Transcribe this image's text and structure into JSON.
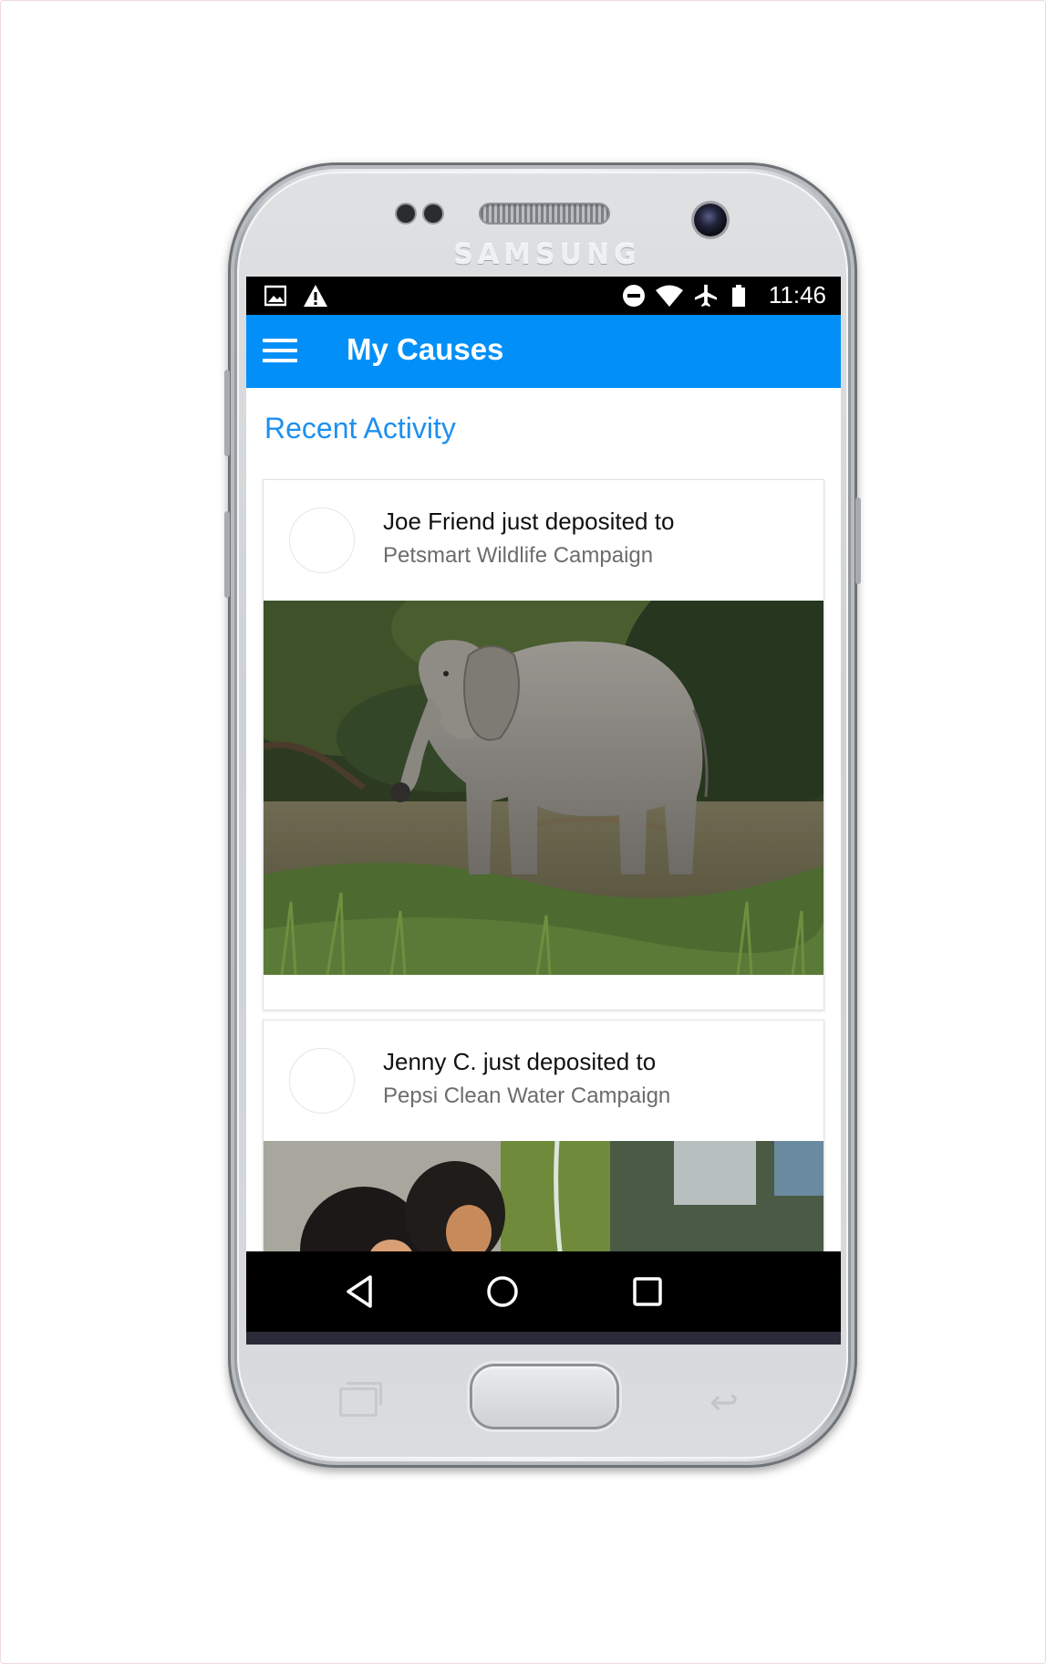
{
  "device": {
    "brand": "SAMSUNG"
  },
  "status_bar": {
    "time": "11:46",
    "left_icons": [
      "image-icon",
      "warning-icon"
    ],
    "right_icons": [
      "do-not-disturb-icon",
      "wifi-icon",
      "airplane-mode-icon",
      "battery-icon"
    ]
  },
  "app_bar": {
    "title": "My Causes",
    "menu_icon": "menu-icon",
    "color": "#0290f8"
  },
  "section": {
    "title": "Recent Activity",
    "color": "#1e90f0"
  },
  "activity": [
    {
      "headline": "Joe Friend just deposited to",
      "campaign": "Petsmart Wildlife Campaign",
      "image": "elephant-photo"
    },
    {
      "headline": "Jenny C. just deposited to",
      "campaign": "Pepsi Clean Water Campaign",
      "image": "children-water-photo"
    }
  ],
  "nav_bar": {
    "buttons": [
      "back-icon",
      "home-icon",
      "recents-icon"
    ]
  }
}
